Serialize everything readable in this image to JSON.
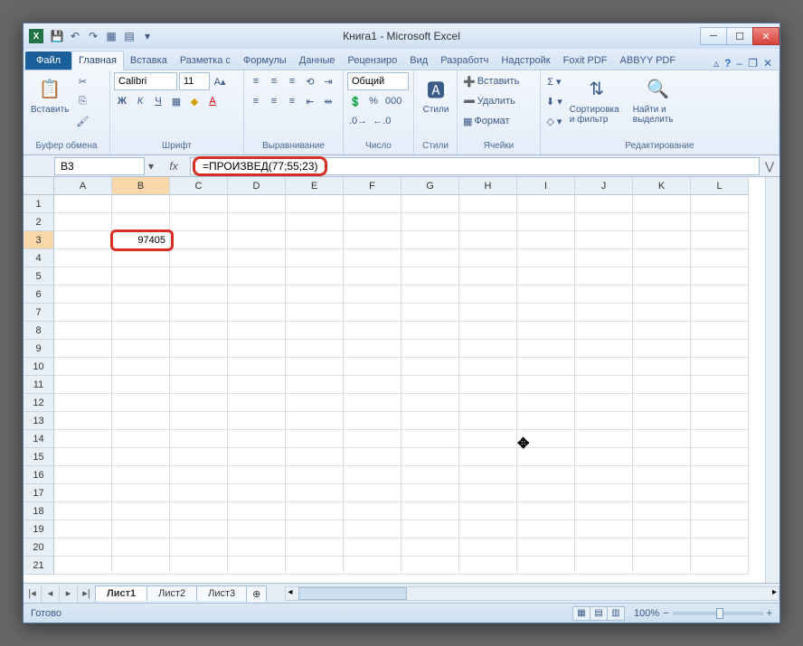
{
  "window": {
    "title": "Книга1 - Microsoft Excel"
  },
  "tabs": {
    "file": "Файл",
    "items": [
      "Главная",
      "Вставка",
      "Разметка с",
      "Формулы",
      "Данные",
      "Рецензиро",
      "Вид",
      "Разработч",
      "Надстройк",
      "Foxit PDF",
      "ABBYY PDF"
    ],
    "active_index": 0
  },
  "ribbon": {
    "clipboard": {
      "paste": "Вставить",
      "label": "Буфер обмена"
    },
    "font": {
      "name": "Calibri",
      "size": "11",
      "label": "Шрифт"
    },
    "alignment": {
      "label": "Выравнивание"
    },
    "number": {
      "format": "Общий",
      "label": "Число"
    },
    "styles": {
      "btn": "Стили",
      "label": "Стили"
    },
    "cells": {
      "insert": "Вставить",
      "delete": "Удалить",
      "format": "Формат",
      "label": "Ячейки"
    },
    "editing": {
      "sort": "Сортировка и фильтр",
      "find": "Найти и выделить",
      "label": "Редактирование"
    }
  },
  "formula_bar": {
    "name_box": "B3",
    "formula": "=ПРОИЗВЕД(77;55;23)"
  },
  "grid": {
    "columns": [
      "A",
      "B",
      "C",
      "D",
      "E",
      "F",
      "G",
      "H",
      "I",
      "J",
      "K",
      "L"
    ],
    "row_count": 21,
    "active_cell": {
      "row": 3,
      "col": "B",
      "value": "97405"
    }
  },
  "sheets": {
    "items": [
      "Лист1",
      "Лист2",
      "Лист3"
    ],
    "active_index": 0
  },
  "statusbar": {
    "ready": "Готово",
    "zoom": "100%"
  }
}
